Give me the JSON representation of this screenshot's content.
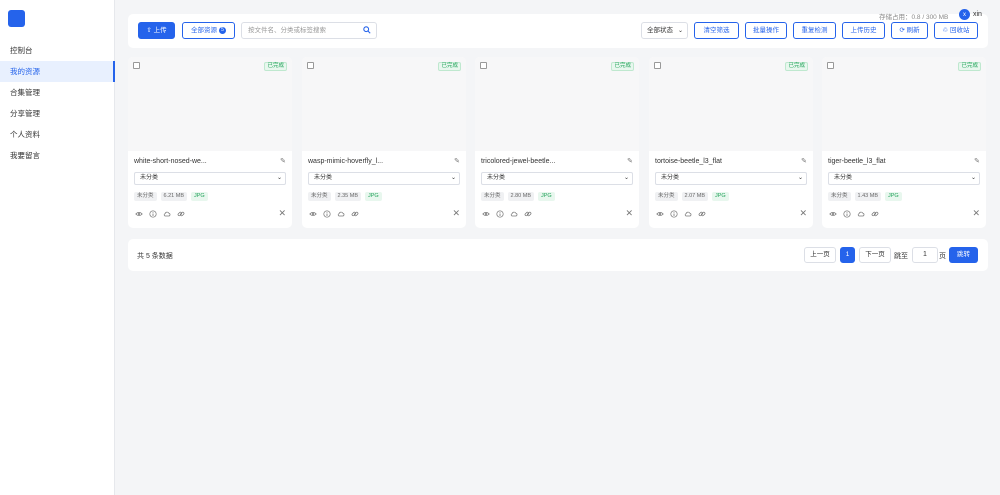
{
  "sidebar": {
    "items": [
      {
        "label": "控制台"
      },
      {
        "label": "我的资源"
      },
      {
        "label": "合集管理"
      },
      {
        "label": "分享管理"
      },
      {
        "label": "个人资料"
      },
      {
        "label": "我要留言"
      }
    ],
    "active_index": 1
  },
  "header": {
    "storage_text": "存储占用：0.8 / 300 MB",
    "user_initial": "x",
    "user_name": "xin"
  },
  "toolbar": {
    "upload_label": "⇧ 上传",
    "all_resources_label": "全部资源",
    "all_resources_count": "5",
    "search_placeholder": "按文件名、分类或标签搜索",
    "status_filter": "全部状态",
    "clear_filter_label": "清空筛选",
    "batch_label": "批量操作",
    "dedupe_label": "重复检测",
    "history_label": "上传历史",
    "refresh_label": "⟳ 刷新",
    "recycle_label": "♲ 回收站"
  },
  "cards": [
    {
      "name": "white-short-nosed-we...",
      "status": "已完成",
      "category": "未分类",
      "tag_category": "未分类",
      "size": "6.21 MB",
      "format": "JPG"
    },
    {
      "name": "wasp-mimic-hoverfly_l...",
      "status": "已完成",
      "category": "未分类",
      "tag_category": "未分类",
      "size": "2.35 MB",
      "format": "JPG"
    },
    {
      "name": "tricolored-jewel-beetle...",
      "status": "已完成",
      "category": "未分类",
      "tag_category": "未分类",
      "size": "2.80 MB",
      "format": "JPG"
    },
    {
      "name": "tortoise-beetle_l3_flat",
      "status": "已完成",
      "category": "未分类",
      "tag_category": "未分类",
      "size": "2.07 MB",
      "format": "JPG"
    },
    {
      "name": "tiger-beetle_l3_flat",
      "status": "已完成",
      "category": "未分类",
      "tag_category": "未分类",
      "size": "1.43 MB",
      "format": "JPG"
    }
  ],
  "pagination": {
    "total_text": "共 5 条数据",
    "prev_label": "上一页",
    "current_page": "1",
    "next_label": "下一页",
    "jump_prefix": "跳至",
    "jump_value": "1",
    "jump_suffix": "页",
    "go_label": "跳转"
  },
  "colors": {
    "accent": "#2563eb",
    "success": "#22a35a"
  }
}
